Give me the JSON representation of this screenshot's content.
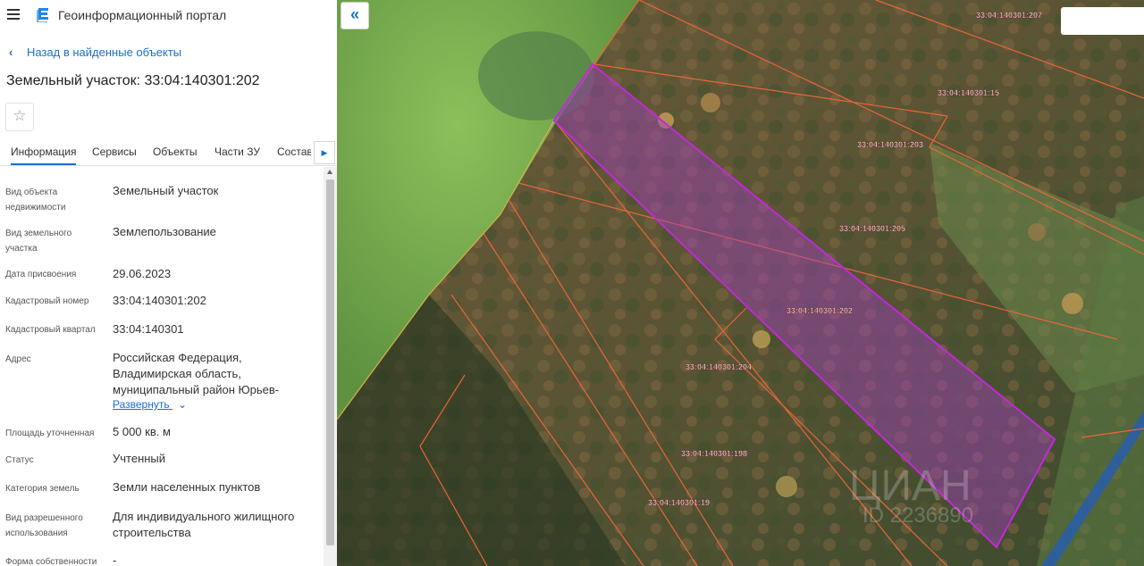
{
  "app": {
    "title": "Геоинформационный портал"
  },
  "nav": {
    "back_label": "Назад в найденные объекты"
  },
  "page": {
    "title": "Земельный участок: 33:04:140301:202"
  },
  "tabs": [
    {
      "label": "Информация"
    },
    {
      "label": "Сервисы"
    },
    {
      "label": "Объекты"
    },
    {
      "label": "Части ЗУ"
    },
    {
      "label": "Состав"
    }
  ],
  "properties": [
    {
      "label": "Вид объекта недвижимости",
      "value": "Земельный участок"
    },
    {
      "label": "Вид земельного участка",
      "value": "Землепользование"
    },
    {
      "label": "Дата присвоения",
      "value": "29.06.2023"
    },
    {
      "label": "Кадастровый номер",
      "value": "33:04:140301:202"
    },
    {
      "label": "Кадастровый квартал",
      "value": "33:04:140301"
    },
    {
      "label": "Адрес",
      "value": "Российская Федерация, Владимирская область, муниципальный район Юрьев-"
    },
    {
      "label": "Площадь уточненная",
      "value": "5 000 кв. м"
    },
    {
      "label": "Статус",
      "value": "Учтенный"
    },
    {
      "label": "Категория земель",
      "value": "Земли населенных пунктов"
    },
    {
      "label": "Вид разрешенного использования",
      "value": "Для индивидуального жилищного строительства"
    },
    {
      "label": "Форма собственности",
      "value": "-"
    }
  ],
  "expand": {
    "label": "Развернуть"
  },
  "map": {
    "parcel_labels": [
      "33:04:140301:207",
      "33:04:140301:15",
      "33:04:140301:203",
      "33:04:140301:205",
      "33:04:140301:202",
      "33:04:140301:204",
      "33:04:140301:198",
      "33:04:140301:19"
    ],
    "watermark": "ЦИАН",
    "watermark_id": "ID 2236890"
  },
  "colors": {
    "accent": "#1a6fc9",
    "parcel_border": "#e8663a",
    "selected_parcel": "#c02ad8"
  }
}
